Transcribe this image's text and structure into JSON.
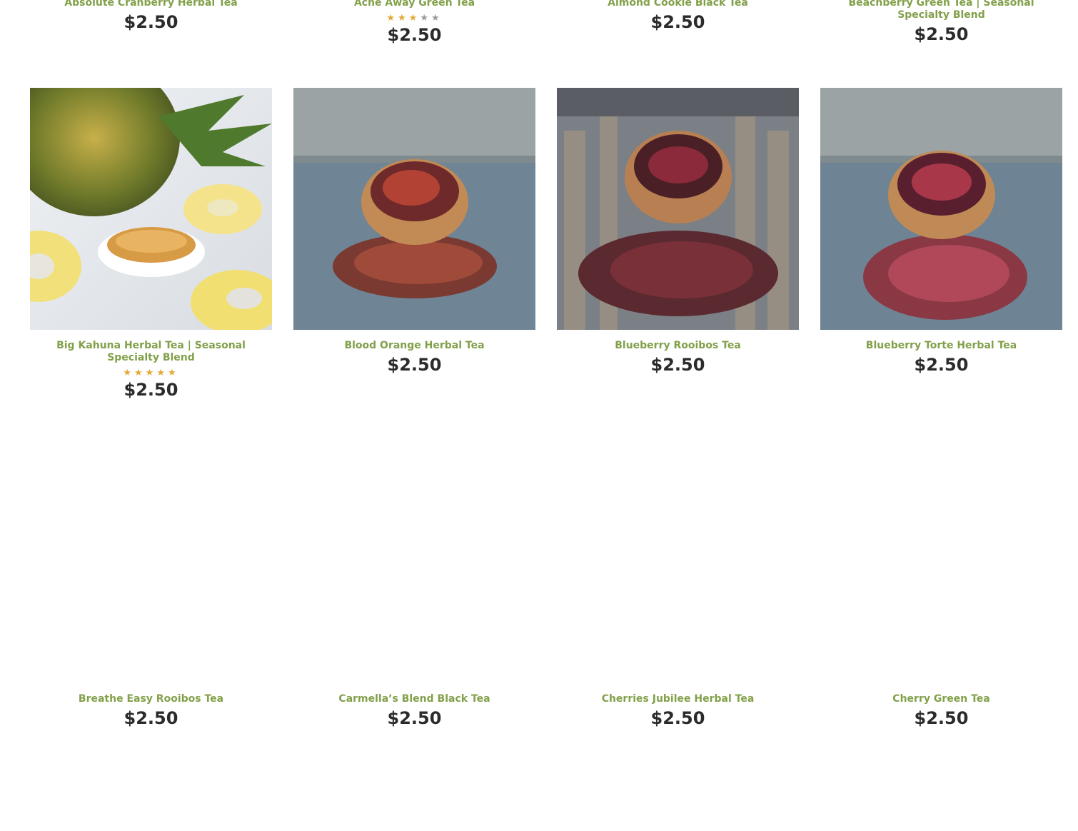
{
  "colors": {
    "product_name": "#82a04a",
    "price": "#2b2b2b",
    "star_filled": "#e2a934",
    "star_empty": "#9b9b9b"
  },
  "rows": [
    {
      "products": [
        {
          "name": "Absolute Cranberry Herbal Tea",
          "price": "$2.50"
        },
        {
          "name": "Ache Away Green Tea",
          "price": "$2.50",
          "rating": 3,
          "rating_max": 5
        },
        {
          "name": "Almond Cookie Black Tea",
          "price": "$2.50"
        },
        {
          "name": "Beachberry Green Tea | Seasonal Specialty Blend",
          "price": "$2.50"
        }
      ]
    },
    {
      "products": [
        {
          "name": "Big Kahuna Herbal Tea | Seasonal Specialty Blend",
          "price": "$2.50",
          "rating": 5,
          "rating_max": 5,
          "image": "pineapple-tea-photo"
        },
        {
          "name": "Blood Orange Herbal Tea",
          "price": "$2.50",
          "image": "blood-orange-tea-photo"
        },
        {
          "name": "Blueberry Rooibos Tea",
          "price": "$2.50",
          "image": "blueberry-rooibos-tea-photo"
        },
        {
          "name": "Blueberry Torte Herbal Tea",
          "price": "$2.50",
          "image": "blueberry-torte-tea-photo"
        }
      ]
    },
    {
      "products": [
        {
          "name": "Breathe Easy Rooibos Tea",
          "price": "$2.50"
        },
        {
          "name": "Carmella’s Blend Black Tea",
          "price": "$2.50"
        },
        {
          "name": "Cherries Jubilee Herbal Tea",
          "price": "$2.50"
        },
        {
          "name": "Cherry Green Tea",
          "price": "$2.50"
        }
      ]
    }
  ]
}
